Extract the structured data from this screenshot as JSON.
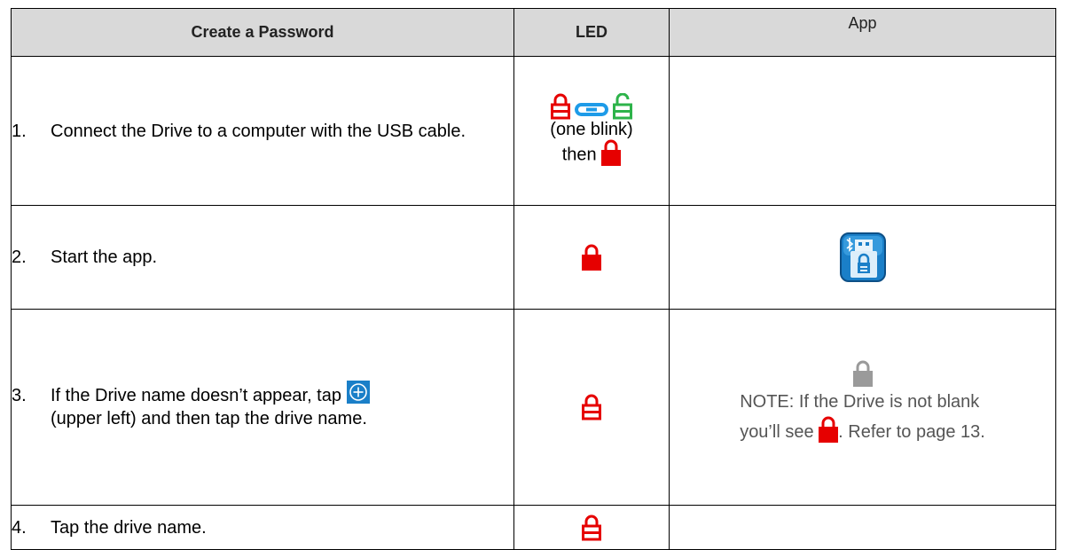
{
  "header": {
    "col_step": "Create a Password",
    "col_led": "LED",
    "col_app": "App"
  },
  "rows": [
    {
      "num": "1.",
      "text": "Connect the Drive to a computer with the USB cable.",
      "led_blink": "(one blink)",
      "led_then": "then",
      "led_icons": [
        "red-outline-lock-icon",
        "blue-link-icon",
        "green-unlock-icon",
        "red-solid-lock-icon"
      ]
    },
    {
      "num": "2.",
      "text": "Start the app.",
      "led_icons": [
        "red-solid-lock-icon"
      ],
      "app_icon": "drive-app-icon"
    },
    {
      "num": "3.",
      "text_before": "If the Drive name doesn’t appear, tap",
      "text_after": "(upper left) and then tap the drive name.",
      "inline_icon": "add-circle-icon",
      "led_icons": [
        "red-outline-lock-icon"
      ],
      "app_icon": "gray-lock-icon",
      "note_line1": "NOTE: If the Drive is not blank",
      "note_pre": "you’ll see",
      "note_post": ". Refer to page 13."
    },
    {
      "num": "4.",
      "text": "Tap the drive name.",
      "led_icons": [
        "red-outline-lock-icon"
      ]
    }
  ],
  "colors": {
    "header_bg": "#d9d9d9",
    "lock_red": "#e60000",
    "lock_green": "#2db34a",
    "link_blue": "#1e9be8",
    "app_blue": "#1a7fc8",
    "lock_gray": "#9a9a9a"
  }
}
